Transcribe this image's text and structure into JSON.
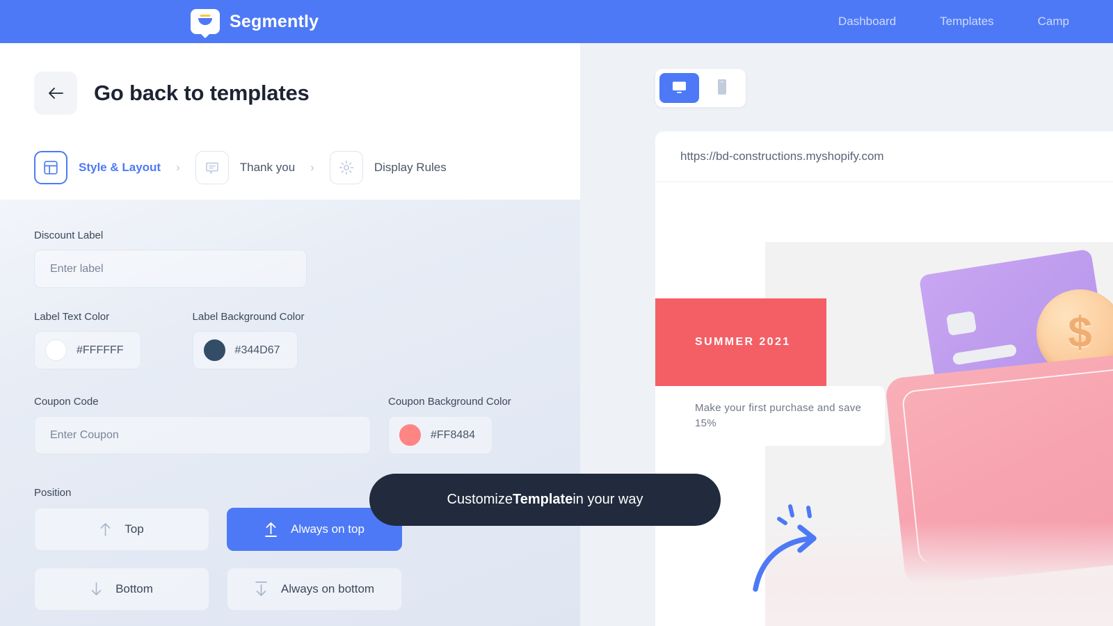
{
  "topnav": {
    "brand_name": "Segmently",
    "brand_icon": "segmently-bubble-logo",
    "links": [
      {
        "label": "Dashboard"
      },
      {
        "label": "Templates"
      },
      {
        "label": "Camp"
      }
    ]
  },
  "editor": {
    "back_icon": "arrow-left-icon",
    "page_title": "Go back to templates",
    "steps": [
      {
        "label": "Style & Layout",
        "icon": "layout-icon",
        "active": true
      },
      {
        "label": "Thank you",
        "icon": "speech-bubble-icon",
        "active": false
      },
      {
        "label": "Display Rules",
        "icon": "gear-icon",
        "active": false
      }
    ],
    "chevron": "›",
    "fields": {
      "discount_label": {
        "label": "Discount Label",
        "placeholder": "Enter label",
        "value": ""
      },
      "label_text_color": {
        "label": "Label Text Color",
        "value": "#FFFFFF"
      },
      "label_background_color": {
        "label": "Label Background Color",
        "value": "#344D67"
      },
      "coupon_code": {
        "label": "Coupon Code",
        "placeholder": "Enter Coupon",
        "value": ""
      },
      "coupon_background_color": {
        "label": "Coupon Background Color",
        "value": "#FF8484"
      }
    },
    "position": {
      "label": "Position",
      "options": [
        {
          "label": "Top",
          "icon": "arrow-up-icon",
          "selected": false
        },
        {
          "label": "Always on top",
          "icon": "arrow-up-to-line-icon",
          "selected": true
        },
        {
          "label": "Bottom",
          "icon": "arrow-down-icon",
          "selected": false
        },
        {
          "label": "Always on bottom",
          "icon": "arrow-down-to-line-icon",
          "selected": false
        }
      ]
    }
  },
  "tooltip": {
    "prefix": "Customize ",
    "bold": "Template",
    "suffix": " in your way"
  },
  "preview": {
    "devices": [
      {
        "name": "desktop",
        "icon": "monitor-icon",
        "active": true
      },
      {
        "name": "mobile",
        "icon": "phone-icon",
        "active": false
      }
    ],
    "url": "https://bd-constructions.myshopify.com",
    "promo": {
      "banner_text": "SUMMER 2021",
      "card_text": "Make your first purchase and save 15%"
    },
    "illustration": "wallet-card-coins-illustration",
    "annotation_icon": "curved-arrow-icon"
  },
  "colors": {
    "brand_blue": "#4D79F6",
    "tooltip_dark": "#212B3D",
    "banner_red": "#F45F65",
    "label_bg": "#344D67",
    "coupon_bg": "#FF8484"
  }
}
